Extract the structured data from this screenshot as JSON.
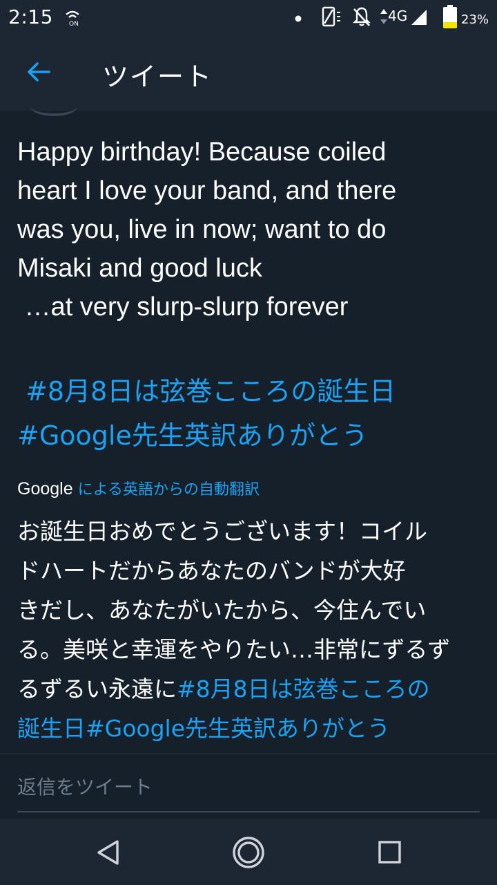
{
  "status_bar": {
    "time": "2:15",
    "network": "4G",
    "battery": "23%"
  },
  "app_bar": {
    "title": "ツイート"
  },
  "tweet": {
    "text_lines": [
      "Happy birthday! Because coiled",
      "heart I love your band, and there",
      "was you, live in now; want to do",
      "Misaki and good luck",
      " …at very slurp-slurp forever"
    ],
    "hashtags": [
      " #8月8日は弦巻こころの誕生日",
      "#Google先生英訳ありがとう"
    ]
  },
  "translation": {
    "provider": "Google",
    "label": "による英語からの自動翻訳",
    "lines": [
      "お誕生日おめでとうございます！コイル",
      "ドハートだからあなたのバンドが大好",
      "きだし、あなたがいたから、今住んでい",
      "る。美咲と幸運をやりたい…非常にずるず"
    ],
    "last_line_text": "るずるい永遠に",
    "last_line_hashtag": "#8月8日は弦巻こころの",
    "final_line": "誕生日#Google先生英訳ありがとう"
  },
  "reply": {
    "placeholder": "返信をツイート"
  },
  "colors": {
    "background": "#15202b",
    "bar": "#1c2733",
    "accent": "#1da1f2",
    "battery": "#f3e300"
  },
  "icons": {
    "status": [
      "nfc-icon",
      "notification-dot-icon",
      "screen-rotate-icon",
      "mute-icon",
      "signal-icon",
      "battery-icon"
    ],
    "app_bar": "back-arrow-icon",
    "nav": [
      "back-triangle-icon",
      "home-circle-icon",
      "recents-square-icon"
    ]
  }
}
